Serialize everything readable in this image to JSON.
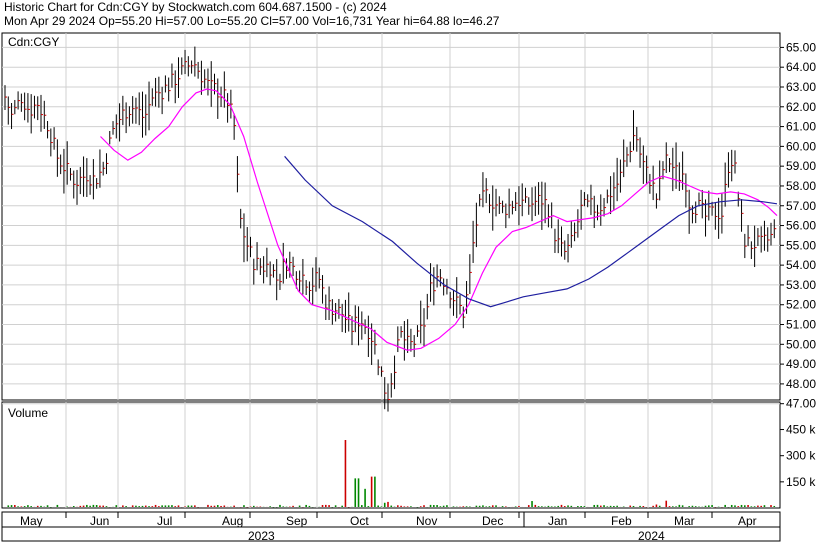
{
  "header": {
    "line1": "Historic Chart for Cdn:CGY by Stockwatch.com 604.687.1500 - (c) 2024",
    "line2": "Mon Apr 29 2024  Op=55.20  Hi=57.00  Lo=55.20  Cl=57.00  Vol=16,731  Year hi=64.88  lo=46.27"
  },
  "chart_data": [
    {
      "type": "bar",
      "title": "Cdn:CGY",
      "ylim": [
        46,
        65.6
      ],
      "yticks": [
        "65.00",
        "64.00",
        "63.00",
        "62.00",
        "61.00",
        "60.00",
        "59.00",
        "58.00",
        "57.00",
        "56.00",
        "55.00",
        "54.00",
        "53.00",
        "52.00",
        "51.00",
        "50.00",
        "49.00",
        "48.00",
        "47.00"
      ],
      "months": [
        "May",
        "Jun",
        "Jul",
        "Aug",
        "Sep",
        "Oct",
        "Nov",
        "Dec",
        "Jan",
        "Feb",
        "Mar",
        "Apr"
      ],
      "years": [
        "2023",
        "2024"
      ],
      "grid": true,
      "price_anchors": [
        [
          0,
          62.5
        ],
        [
          5,
          61.5
        ],
        [
          12,
          62.5
        ],
        [
          18,
          61.8
        ],
        [
          24,
          62.2
        ],
        [
          32,
          61.0
        ],
        [
          38,
          59.5
        ],
        [
          45,
          58.8
        ],
        [
          52,
          58.2
        ],
        [
          60,
          58.6
        ],
        [
          66,
          58.3
        ],
        [
          72,
          58.9
        ],
        [
          80,
          61.0
        ],
        [
          88,
          61.8
        ],
        [
          95,
          62.0
        ],
        [
          102,
          61.4
        ],
        [
          108,
          62.5
        ],
        [
          115,
          62.8
        ],
        [
          122,
          63.2
        ],
        [
          130,
          63.8
        ],
        [
          138,
          64.3
        ],
        [
          144,
          63.6
        ],
        [
          150,
          63.0
        ],
        [
          157,
          62.8
        ],
        [
          164,
          62.2
        ],
        [
          168,
          61.0
        ],
        [
          172,
          56.5
        ],
        [
          176,
          55.3
        ],
        [
          182,
          54.2
        ],
        [
          188,
          53.9
        ],
        [
          194,
          54.0
        ],
        [
          200,
          53.2
        ],
        [
          206,
          54.2
        ],
        [
          212,
          53.8
        ],
        [
          218,
          53.5
        ],
        [
          224,
          53.0
        ],
        [
          230,
          53.4
        ],
        [
          236,
          52.0
        ],
        [
          242,
          51.8
        ],
        [
          248,
          51.5
        ],
        [
          254,
          50.8
        ],
        [
          260,
          51.3
        ],
        [
          266,
          50.8
        ],
        [
          270,
          50.2
        ],
        [
          276,
          48.5
        ],
        [
          280,
          47.2
        ],
        [
          285,
          48.8
        ],
        [
          290,
          50.5
        ],
        [
          296,
          49.9
        ],
        [
          302,
          50.2
        ],
        [
          308,
          51.2
        ],
        [
          312,
          52.8
        ],
        [
          318,
          53.6
        ],
        [
          324,
          53.0
        ],
        [
          330,
          52.2
        ],
        [
          336,
          51.6
        ],
        [
          340,
          52.9
        ],
        [
          344,
          55.6
        ],
        [
          348,
          56.9
        ],
        [
          352,
          57.6
        ],
        [
          358,
          57.2
        ],
        [
          364,
          56.8
        ],
        [
          370,
          57.0
        ],
        [
          376,
          57.3
        ],
        [
          382,
          57.0
        ],
        [
          388,
          57.2
        ],
        [
          394,
          57.3
        ],
        [
          398,
          57.0
        ],
        [
          402,
          55.8
        ],
        [
          406,
          55.0
        ],
        [
          410,
          54.6
        ],
        [
          414,
          54.9
        ],
        [
          418,
          55.6
        ],
        [
          422,
          56.8
        ],
        [
          428,
          57.0
        ],
        [
          434,
          56.8
        ],
        [
          440,
          57.2
        ],
        [
          446,
          57.9
        ],
        [
          450,
          58.2
        ],
        [
          454,
          59.2
        ],
        [
          458,
          59.9
        ],
        [
          462,
          60.8
        ],
        [
          466,
          59.5
        ],
        [
          470,
          58.7
        ],
        [
          474,
          58.2
        ],
        [
          478,
          57.3
        ],
        [
          482,
          58.8
        ],
        [
          486,
          59.4
        ],
        [
          490,
          58.9
        ],
        [
          494,
          58.5
        ],
        [
          498,
          58.7
        ],
        [
          502,
          57.0
        ],
        [
          508,
          57.0
        ],
        [
          514,
          56.4
        ],
        [
          520,
          56.7
        ],
        [
          526,
          56.6
        ],
        [
          530,
          59.0
        ],
        [
          534,
          59.5
        ],
        [
          538,
          57.2
        ],
        [
          542,
          55.3
        ],
        [
          546,
          55.0
        ],
        [
          550,
          55.1
        ],
        [
          554,
          55.0
        ],
        [
          560,
          55.3
        ],
        [
          566,
          55.8
        ]
      ],
      "series": [
        {
          "name": "MA (magenta)",
          "color": "#ff00ff",
          "points": [
            [
              70,
              60.5
            ],
            [
              80,
              59.8
            ],
            [
              90,
              59.3
            ],
            [
              100,
              59.7
            ],
            [
              110,
              60.4
            ],
            [
              120,
              61.0
            ],
            [
              130,
              62.0
            ],
            [
              140,
              62.7
            ],
            [
              148,
              62.9
            ],
            [
              155,
              62.8
            ],
            [
              165,
              62.1
            ],
            [
              175,
              60.5
            ],
            [
              185,
              58.2
            ],
            [
              200,
              55.0
            ],
            [
              215,
              52.7
            ],
            [
              225,
              52.0
            ],
            [
              240,
              51.7
            ],
            [
              255,
              51.2
            ],
            [
              268,
              50.8
            ],
            [
              280,
              50.1
            ],
            [
              295,
              49.7
            ],
            [
              305,
              49.8
            ],
            [
              318,
              50.3
            ],
            [
              330,
              51.0
            ],
            [
              340,
              52.0
            ],
            [
              350,
              53.6
            ],
            [
              360,
              54.9
            ],
            [
              372,
              55.7
            ],
            [
              382,
              55.9
            ],
            [
              392,
              56.2
            ],
            [
              402,
              56.5
            ],
            [
              412,
              56.2
            ],
            [
              422,
              56.3
            ],
            [
              432,
              56.4
            ],
            [
              442,
              56.6
            ],
            [
              452,
              57.0
            ],
            [
              462,
              57.6
            ],
            [
              472,
              58.2
            ],
            [
              482,
              58.5
            ],
            [
              492,
              58.3
            ],
            [
              502,
              58.0
            ],
            [
              512,
              57.7
            ],
            [
              522,
              57.6
            ],
            [
              532,
              57.7
            ],
            [
              542,
              57.6
            ],
            [
              552,
              57.3
            ],
            [
              560,
              56.9
            ],
            [
              566,
              56.5
            ]
          ]
        },
        {
          "name": "MA (blue)",
          "color": "#1f1fa0",
          "points": [
            [
              205,
              59.5
            ],
            [
              220,
              58.3
            ],
            [
              240,
              57.0
            ],
            [
              262,
              56.2
            ],
            [
              284,
              55.2
            ],
            [
              302,
              54.1
            ],
            [
              322,
              53.0
            ],
            [
              340,
              52.3
            ],
            [
              356,
              51.9
            ],
            [
              366,
              52.1
            ],
            [
              380,
              52.4
            ],
            [
              396,
              52.6
            ],
            [
              412,
              52.8
            ],
            [
              428,
              53.3
            ],
            [
              442,
              53.9
            ],
            [
              456,
              54.6
            ],
            [
              470,
              55.3
            ],
            [
              482,
              55.9
            ],
            [
              494,
              56.5
            ],
            [
              508,
              57.0
            ],
            [
              524,
              57.2
            ],
            [
              540,
              57.3
            ],
            [
              556,
              57.2
            ],
            [
              566,
              57.1
            ]
          ]
        }
      ]
    },
    {
      "type": "bar",
      "title": "Volume",
      "yticks": [
        "450 k",
        "300 k",
        "150 k"
      ],
      "ylim": [
        0,
        520000
      ],
      "spikes": [
        [
          145,
          390000
        ],
        [
          150,
          170000
        ],
        [
          154,
          110000
        ],
        [
          157,
          180000
        ],
        [
          162,
          30000
        ],
        [
          163,
          35000
        ],
        [
          225,
          40000
        ],
        [
          278,
          20000
        ],
        [
          282,
          42000
        ],
        [
          332,
          120000
        ],
        [
          336,
          40000
        ],
        [
          380,
          30000
        ],
        [
          421,
          15000
        ]
      ]
    }
  ]
}
